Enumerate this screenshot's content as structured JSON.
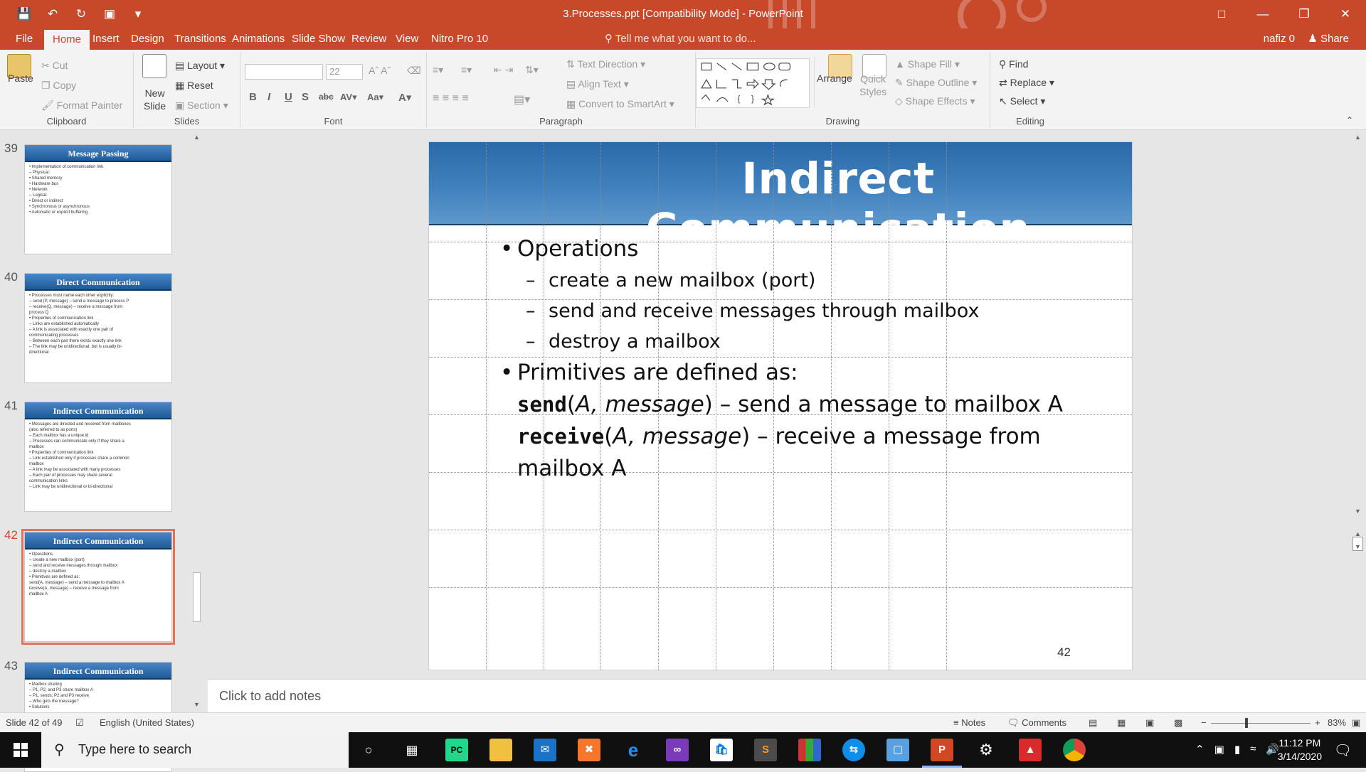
{
  "window": {
    "title": "3.Processes.ppt [Compatibility Mode] - PowerPoint",
    "user": "nafiz 0",
    "share_label": "Share",
    "quick_access": [
      "save-icon",
      "undo-icon",
      "redo-icon",
      "present-icon",
      "customize-icon"
    ]
  },
  "tabs": [
    "File",
    "Home",
    "Insert",
    "Design",
    "Transitions",
    "Animations",
    "Slide Show",
    "Review",
    "View",
    "Nitro Pro 10"
  ],
  "active_tab": "Home",
  "tell_me": "Tell me what you want to do...",
  "ribbon": {
    "clipboard": {
      "label": "Clipboard",
      "paste": "Paste",
      "cut": "Cut",
      "copy": "Copy",
      "format_painter": "Format Painter"
    },
    "slides": {
      "label": "Slides",
      "new_slide": "New",
      "new_slide_2": "Slide",
      "layout": "Layout",
      "reset": "Reset",
      "section": "Section"
    },
    "font": {
      "label": "Font",
      "font_name": "",
      "font_size": "22"
    },
    "paragraph": {
      "label": "Paragraph",
      "text_direction": "Text Direction",
      "align_text": "Align Text",
      "convert_smartart": "Convert to SmartArt"
    },
    "drawing": {
      "label": "Drawing",
      "arrange": "Arrange",
      "quick_styles": "Quick",
      "quick_styles_2": "Styles",
      "shape_fill": "Shape Fill",
      "shape_outline": "Shape Outline",
      "shape_effects": "Shape Effects"
    },
    "editing": {
      "label": "Editing",
      "find": "Find",
      "replace": "Replace",
      "select": "Select"
    }
  },
  "thumbnails": [
    {
      "num": "39",
      "title": "Message Passing",
      "lines": [
        "• Implementation of communication link",
        "  – Physical:",
        "     • Shared memory",
        "     • Hardware bus",
        "     • Network",
        "  – Logical:",
        "     • Direct or indirect",
        "     • Synchronous or asynchronous",
        "     • Automatic or explicit buffering"
      ]
    },
    {
      "num": "40",
      "title": "Direct Communication",
      "lines": [
        "• Processes must name each other explicitly:",
        "  – send (P, message) – send a message to process P",
        "  – receive(Q, message) – receive a message from",
        "    process Q",
        "• Properties of communication link",
        "  – Links are established automatically",
        "  – A link is associated with exactly one pair of",
        "    communicating processes",
        "  – Between each pair there exists exactly one link",
        "  – The link may be unidirectional, but is usually bi-",
        "    directional"
      ]
    },
    {
      "num": "41",
      "title": "Indirect Communication",
      "lines": [
        "• Messages are directed and received from mailboxes",
        "  (also referred to as ports)",
        "  – Each mailbox has a unique id",
        "  – Processes can communicate only if they share a",
        "    mailbox",
        "• Properties of communication link",
        "  – Link established only if processes share a common",
        "    mailbox",
        "  – A link may be associated with many processes",
        "  – Each pair of processes may share several",
        "    communication links",
        "  – Link may be unidirectional or bi-directional"
      ]
    },
    {
      "num": "42",
      "title": "Indirect Communication",
      "lines": [
        "• Operations",
        "  – create a new mailbox (port)",
        "  – send and receive messages through mailbox",
        "  – destroy a mailbox",
        "• Primitives are defined as:",
        "send(A, message) – send a message to mailbox A",
        "receive(A, message) – receive a message from",
        "mailbox A"
      ]
    },
    {
      "num": "43",
      "title": "Indirect Communication",
      "lines": [
        "• Mailbox sharing",
        "  – P1, P2, and P3 share mailbox A",
        "  – P1, sends; P2 and P3 receive",
        "  – Who gets the message?",
        "• Solutions"
      ]
    }
  ],
  "slide": {
    "title": "Indirect Communication",
    "bullet1": "Operations",
    "sub1": "create a new mailbox (port)",
    "sub2": "send and receive messages through mailbox",
    "sub3": "destroy a mailbox",
    "bullet2": "Primitives are defined as:",
    "send_fn": "send",
    "send_args": "A, message",
    "send_desc": ") – send a message to mailbox A",
    "recv_fn": "receive",
    "recv_args": "A, message",
    "recv_desc": ") – receive a message from",
    "recv_desc2": "mailbox A",
    "number": "42"
  },
  "notes_placeholder": "Click to add notes",
  "status": {
    "slide_info": "Slide 42 of 49",
    "language": "English (United States)",
    "notes": "Notes",
    "comments": "Comments",
    "zoom": "83%"
  },
  "taskbar": {
    "search_placeholder": "Type here to search",
    "time": "11:12 PM",
    "date": "3/14/2020",
    "apps": [
      "task-view",
      "pycharm",
      "file-explorer",
      "mail",
      "xampp",
      "edge",
      "visual-studio",
      "store",
      "sublime-text",
      "winrar",
      "teamviewer",
      "virtualbox",
      "powerpoint",
      "settings",
      "acrobat",
      "chrome"
    ]
  },
  "colors": {
    "accent": "#c8482a",
    "slide_header": "#3f80bd"
  }
}
